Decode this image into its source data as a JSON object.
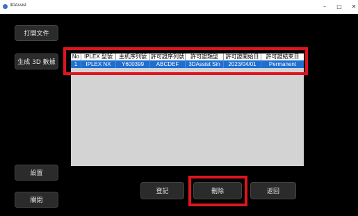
{
  "window": {
    "title": "3DAssist",
    "minimize_glyph": "–",
    "maximize_glyph": "□",
    "close_glyph": "✕"
  },
  "sidebar": {
    "open_file_label": "打開文件",
    "generate_3d_label": "生成 3D 數據",
    "settings_label": "設置",
    "close_label": "關閉"
  },
  "table": {
    "headers": [
      "No",
      "IPLEX 型號",
      "主机序列號",
      "許可證序列號",
      "許可證類型",
      "許可證開始日",
      "許可證結束日"
    ],
    "rows": [
      [
        "1",
        "IPLEX NX",
        "Y600399",
        "ABCDEF",
        "3DAssist Sin",
        "2023/04/01",
        "Permanent"
      ]
    ]
  },
  "actions": {
    "register_label": "登記",
    "delete_label": "刪除",
    "back_label": "返回"
  },
  "colors": {
    "background": "#000000",
    "selected_row": "#1f6fd1",
    "table_body": "#d3d3d3",
    "highlight": "#e0141e"
  }
}
